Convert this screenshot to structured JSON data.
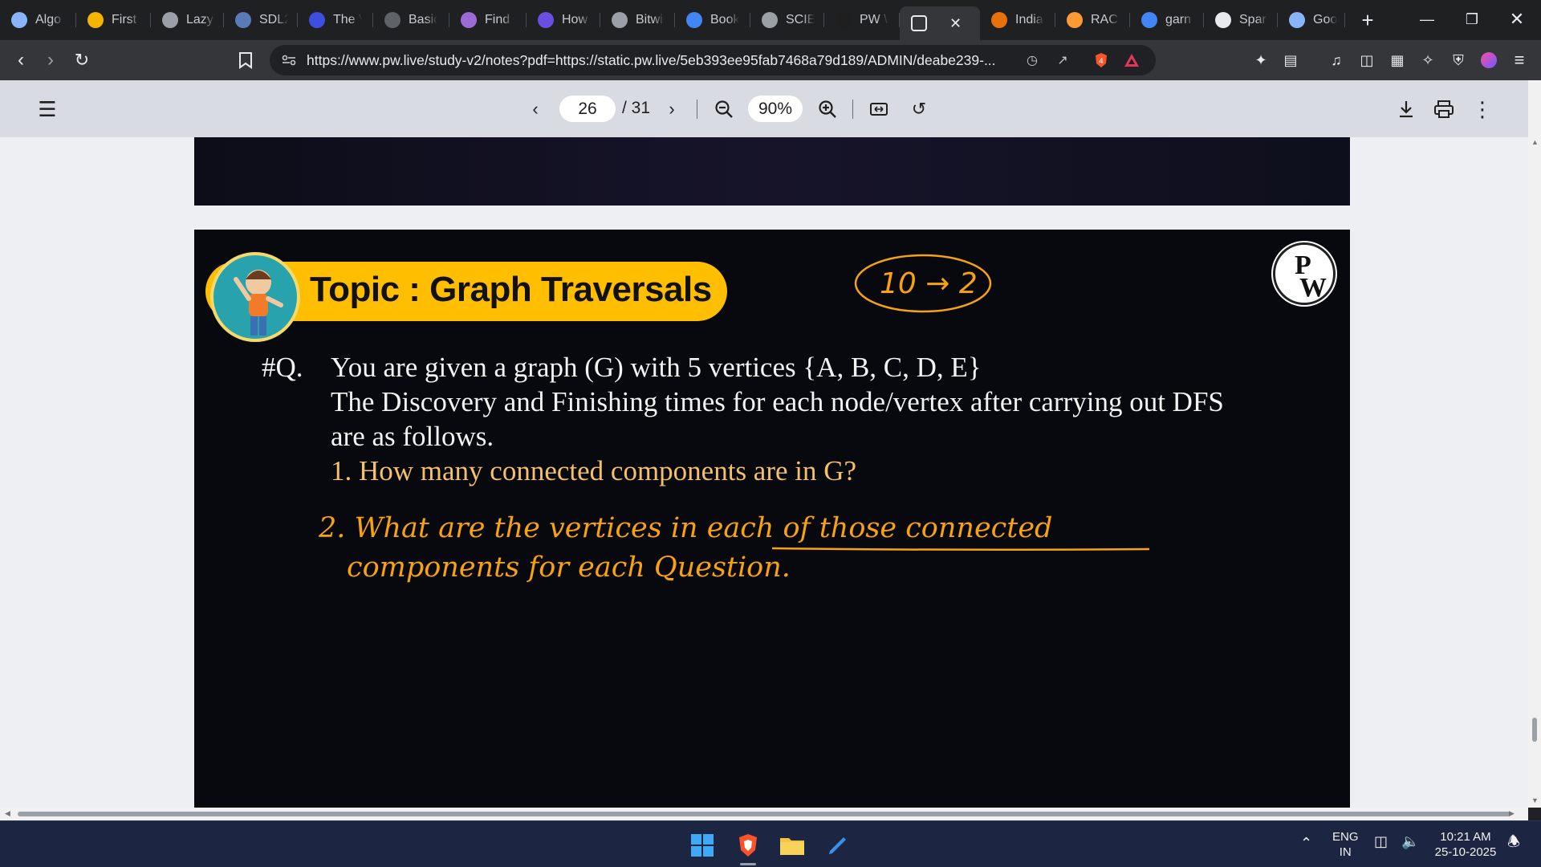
{
  "tabs": [
    {
      "title": "Algo",
      "icon": "globe-icon",
      "color": "#8ab4f8"
    },
    {
      "title": "First",
      "icon": "stack-icon",
      "color": "#f4b400"
    },
    {
      "title": "Lazy",
      "icon": "globe-icon",
      "color": "#9aa0a6"
    },
    {
      "title": "SDL2",
      "icon": "sdl-icon",
      "color": "#5b7bb8"
    },
    {
      "title": "The V",
      "icon": "site-icon",
      "color": "#3c4fe0"
    },
    {
      "title": "Basic",
      "icon": "code-icon",
      "color": "#5f6368"
    },
    {
      "title": "Find",
      "icon": "brain-icon",
      "color": "#9c6bd8"
    },
    {
      "title": "How",
      "icon": "stack-icon",
      "color": "#6b4fe0"
    },
    {
      "title": "Bitwi",
      "icon": "code-icon",
      "color": "#9aa0a6"
    },
    {
      "title": "Book",
      "icon": "google-icon",
      "color": "#4285f4"
    },
    {
      "title": "SCIE",
      "icon": "globe-icon",
      "color": "#9aa0a6"
    },
    {
      "title": "PW \\",
      "icon": "pw-icon",
      "color": "#1f1f1f"
    },
    {
      "title": "",
      "icon": "pw-icon",
      "color": "#ffffff"
    },
    {
      "title": "India",
      "icon": "site-icon",
      "color": "#e8710a"
    },
    {
      "title": "RAC",
      "icon": "flag-icon",
      "color": "#ff9933"
    },
    {
      "title": "garn",
      "icon": "google-icon",
      "color": "#4285f4"
    },
    {
      "title": "Spar",
      "icon": "openai-icon",
      "color": "#e8eaed"
    },
    {
      "title": "Goo",
      "icon": "gemini-icon",
      "color": "#8ab4f8"
    }
  ],
  "url": "https://www.pw.live/study-v2/notes?pdf=https://static.pw.live/5eb393ee95fab7468a79d189/ADMIN/deabe239-...",
  "url_domain": "www.pw.live",
  "pdf": {
    "page_current": "26",
    "page_total": "/ 31",
    "zoom": "90%"
  },
  "slide": {
    "topic": "Topic : Graph Traversals",
    "question_marker": "#Q.",
    "line1": "You are given a graph (G) with 5 vertices {A, B, C, D, E}",
    "line2": "The Discovery and Finishing times for each node/vertex after carrying out DFS",
    "line3": "are as follows.",
    "line4": "1. How many connected components are in G?",
    "handwritten_note": "10 → 2",
    "handwritten_q2_line1": "2. What are the vertices in each of those connected",
    "handwritten_q2_line2": "components for each Question.",
    "logo_letters": "PW"
  },
  "taskbar": {
    "lang": "ENG",
    "region": "IN",
    "time": "10:21 AM",
    "date": "25-10-2025"
  }
}
